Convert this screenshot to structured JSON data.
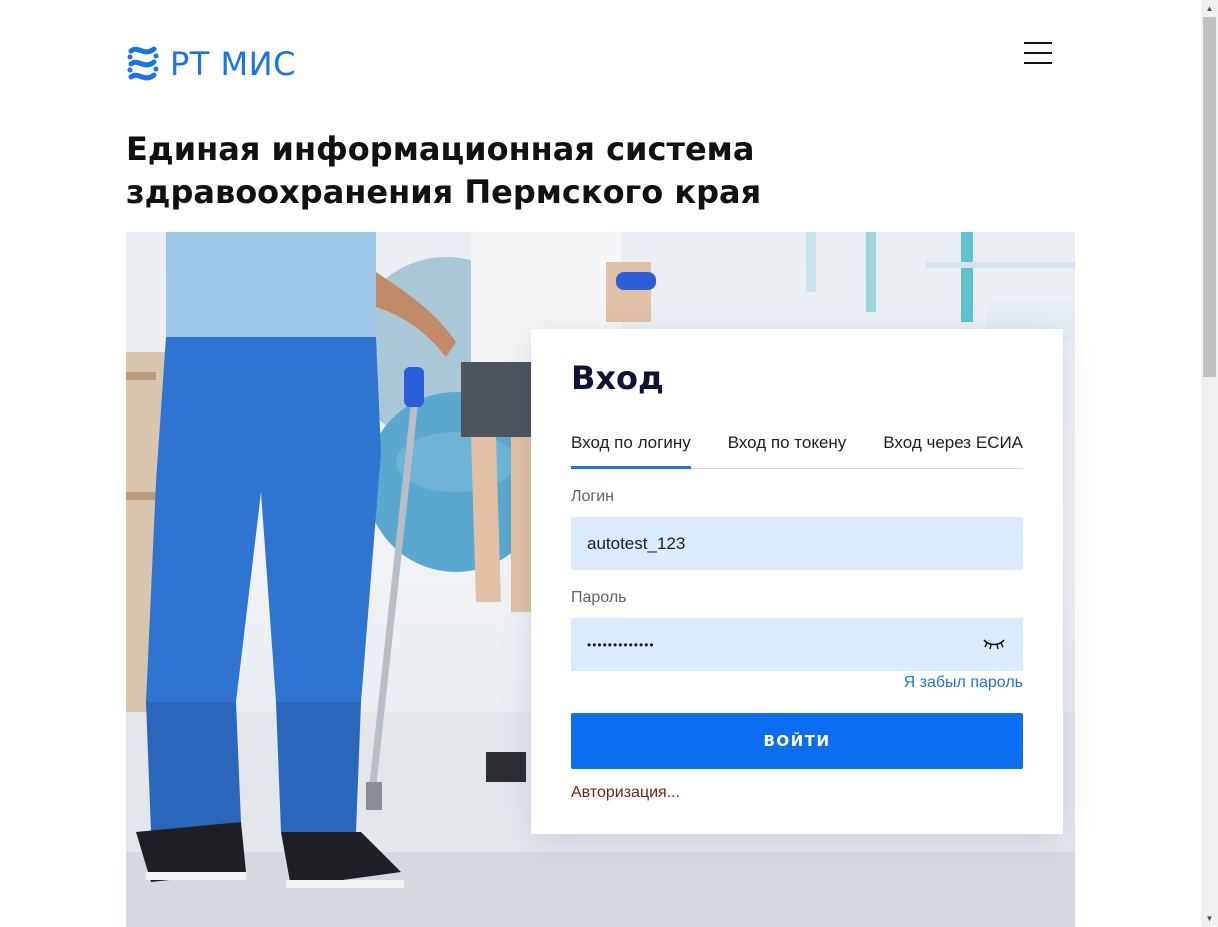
{
  "header": {
    "logo_text": "РТ МИС",
    "menu_icon": "hamburger-menu-icon"
  },
  "page": {
    "title": "Единая информационная система здравоохранения Пермского края"
  },
  "hero": {
    "image": "physiotherapy-photo"
  },
  "login": {
    "title": "Вход",
    "tabs": [
      {
        "label": "Вход по логину",
        "active": true
      },
      {
        "label": "Вход по токену",
        "active": false
      },
      {
        "label": "Вход через ЕСИА",
        "active": false
      }
    ],
    "login_label": "Логин",
    "login_value": "autotest_123",
    "password_label": "Пароль",
    "password_value": "•••••••••••••",
    "password_toggle_icon": "eye-closed-icon",
    "forgot_link": "Я забыл пароль",
    "submit_label": "ВОЙТИ",
    "status_text": "Авторизация..."
  },
  "colors": {
    "accent": "#1a73e8",
    "button": "#0b6ef0",
    "field_bg": "#dceafd",
    "status": "#7a1e14"
  }
}
